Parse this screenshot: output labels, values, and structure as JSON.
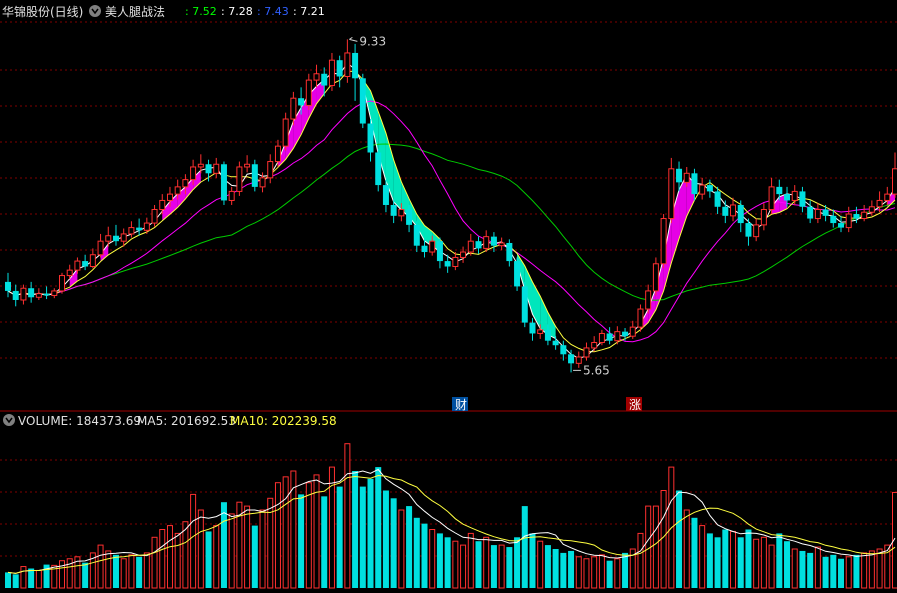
{
  "header": {
    "stock_name": "华锦股份(日线)",
    "indicator_name": "美人腿战法",
    "values": [
      {
        "text": ": 7.52",
        "color": "#00ff00"
      },
      {
        "text": ": 7.28",
        "color": "#ffffff"
      },
      {
        "text": ": 7.43",
        "color": "#3060ff"
      },
      {
        "text": ": 7.21",
        "color": "#ffffff"
      }
    ]
  },
  "volume_header": {
    "volume_text": "VOLUME: 184373.69",
    "ma5_text": "MA5: 201692.53",
    "ma10_text": "MA10: 202239.58"
  },
  "annotations": {
    "high": "9.33",
    "low": "5.65",
    "cai_tag": "财",
    "zhang_tag": "涨"
  },
  "colors": {
    "up": "#ff3030",
    "down": "#00e0e0",
    "ma_short": "#ffffff",
    "ma_mid": "#ffff40",
    "ma_long": "#ff00ff",
    "ma_longest": "#00cc00",
    "grid": "#800000",
    "fill_up": "#ff00ff",
    "fill_down": "#00ffd0"
  },
  "chart_data": {
    "type": "candlestick",
    "ylim": [
      5.4,
      9.5
    ],
    "vol_max": 400000,
    "candles": [
      [
        6.65,
        6.55,
        6.75,
        6.48
      ],
      [
        6.55,
        6.45,
        6.62,
        6.38
      ],
      [
        6.45,
        6.58,
        6.62,
        6.4
      ],
      [
        6.58,
        6.48,
        6.65,
        6.42
      ],
      [
        6.48,
        6.52,
        6.58,
        6.45
      ],
      [
        6.52,
        6.5,
        6.6,
        6.46
      ],
      [
        6.5,
        6.55,
        6.58,
        6.47
      ],
      [
        6.55,
        6.72,
        6.75,
        6.52
      ],
      [
        6.72,
        6.78,
        6.84,
        6.68
      ],
      [
        6.78,
        6.88,
        6.92,
        6.74
      ],
      [
        6.88,
        6.82,
        6.95,
        6.78
      ],
      [
        6.82,
        6.95,
        7.02,
        6.8
      ],
      [
        6.95,
        7.1,
        7.18,
        6.92
      ],
      [
        7.1,
        7.16,
        7.26,
        7.04
      ],
      [
        7.16,
        7.1,
        7.28,
        7.05
      ],
      [
        7.1,
        7.18,
        7.24,
        7.04
      ],
      [
        7.18,
        7.25,
        7.32,
        7.14
      ],
      [
        7.25,
        7.22,
        7.35,
        7.16
      ],
      [
        7.22,
        7.3,
        7.36,
        7.18
      ],
      [
        7.3,
        7.45,
        7.5,
        7.26
      ],
      [
        7.45,
        7.55,
        7.62,
        7.4
      ],
      [
        7.55,
        7.62,
        7.7,
        7.48
      ],
      [
        7.62,
        7.7,
        7.78,
        7.56
      ],
      [
        7.7,
        7.78,
        7.84,
        7.62
      ],
      [
        7.78,
        7.92,
        8.0,
        7.72
      ],
      [
        7.92,
        7.95,
        8.06,
        7.85
      ],
      [
        7.95,
        7.85,
        8.0,
        7.76
      ],
      [
        7.85,
        7.95,
        8.02,
        7.8
      ],
      [
        7.95,
        7.55,
        7.98,
        7.5
      ],
      [
        7.55,
        7.65,
        7.7,
        7.5
      ],
      [
        7.65,
        7.92,
        7.98,
        7.6
      ],
      [
        7.92,
        7.95,
        8.05,
        7.86
      ],
      [
        7.95,
        7.7,
        8.0,
        7.65
      ],
      [
        7.7,
        7.8,
        7.86,
        7.64
      ],
      [
        7.8,
        7.98,
        8.06,
        7.74
      ],
      [
        7.98,
        8.15,
        8.22,
        7.92
      ],
      [
        8.15,
        8.45,
        8.52,
        8.1
      ],
      [
        8.45,
        8.68,
        8.75,
        8.38
      ],
      [
        8.68,
        8.6,
        8.8,
        8.5
      ],
      [
        8.6,
        8.88,
        8.95,
        8.55
      ],
      [
        8.88,
        8.95,
        9.05,
        8.8
      ],
      [
        8.95,
        8.82,
        9.02,
        8.7
      ],
      [
        8.82,
        9.1,
        9.18,
        8.76
      ],
      [
        9.1,
        8.92,
        9.15,
        8.8
      ],
      [
        8.92,
        9.18,
        9.33,
        8.85
      ],
      [
        9.18,
        8.9,
        9.28,
        8.65
      ],
      [
        8.9,
        8.4,
        8.95,
        8.35
      ],
      [
        8.4,
        8.08,
        8.45,
        7.98
      ],
      [
        8.08,
        7.72,
        8.12,
        7.65
      ],
      [
        7.72,
        7.5,
        7.78,
        7.42
      ],
      [
        7.5,
        7.38,
        7.56,
        7.3
      ],
      [
        7.38,
        7.45,
        7.52,
        7.32
      ],
      [
        7.45,
        7.28,
        7.5,
        7.2
      ],
      [
        7.28,
        7.05,
        7.32,
        6.98
      ],
      [
        7.05,
        6.98,
        7.12,
        6.92
      ],
      [
        6.98,
        7.1,
        7.16,
        6.94
      ],
      [
        7.1,
        6.88,
        7.14,
        6.8
      ],
      [
        6.88,
        6.82,
        6.95,
        6.75
      ],
      [
        6.82,
        6.92,
        6.98,
        6.78
      ],
      [
        6.92,
        6.98,
        7.04,
        6.86
      ],
      [
        6.98,
        7.1,
        7.18,
        6.94
      ],
      [
        7.1,
        7.02,
        7.15,
        6.96
      ],
      [
        7.02,
        7.15,
        7.22,
        6.98
      ],
      [
        7.15,
        7.05,
        7.2,
        6.98
      ],
      [
        7.05,
        7.08,
        7.14,
        7.0
      ],
      [
        7.08,
        6.88,
        7.12,
        6.82
      ],
      [
        6.88,
        6.6,
        6.92,
        6.55
      ],
      [
        6.6,
        6.2,
        6.65,
        6.15
      ],
      [
        6.2,
        6.08,
        6.25,
        6.0
      ],
      [
        6.08,
        6.12,
        6.18,
        6.02
      ],
      [
        6.12,
        6.0,
        6.18,
        5.95
      ],
      [
        6.0,
        5.95,
        6.05,
        5.9
      ],
      [
        5.95,
        5.85,
        6.0,
        5.78
      ],
      [
        5.85,
        5.75,
        5.9,
        5.65
      ],
      [
        5.75,
        5.82,
        5.88,
        5.7
      ],
      [
        5.82,
        5.92,
        5.98,
        5.78
      ],
      [
        5.92,
        5.98,
        6.05,
        5.88
      ],
      [
        5.98,
        6.08,
        6.12,
        5.95
      ],
      [
        6.08,
        6.0,
        6.15,
        5.96
      ],
      [
        6.0,
        6.1,
        6.16,
        5.96
      ],
      [
        6.1,
        6.05,
        6.14,
        6.0
      ],
      [
        6.05,
        6.15,
        6.22,
        6.02
      ],
      [
        6.15,
        6.35,
        6.4,
        6.1
      ],
      [
        6.35,
        6.55,
        6.62,
        6.3
      ],
      [
        6.55,
        6.85,
        6.92,
        6.5
      ],
      [
        6.85,
        7.35,
        7.4,
        6.8
      ],
      [
        7.35,
        7.9,
        8.02,
        7.3
      ],
      [
        7.9,
        7.75,
        7.98,
        7.65
      ],
      [
        7.75,
        7.85,
        7.92,
        7.7
      ],
      [
        7.85,
        7.62,
        7.9,
        7.55
      ],
      [
        7.62,
        7.72,
        7.8,
        7.56
      ],
      [
        7.72,
        7.65,
        7.78,
        7.58
      ],
      [
        7.65,
        7.48,
        7.7,
        7.4
      ],
      [
        7.48,
        7.38,
        7.55,
        7.3
      ],
      [
        7.38,
        7.5,
        7.58,
        7.32
      ],
      [
        7.5,
        7.3,
        7.55,
        7.2
      ],
      [
        7.3,
        7.15,
        7.35,
        7.05
      ],
      [
        7.15,
        7.28,
        7.35,
        7.1
      ],
      [
        7.28,
        7.45,
        7.52,
        7.22
      ],
      [
        7.45,
        7.7,
        7.8,
        7.4
      ],
      [
        7.7,
        7.62,
        7.78,
        7.55
      ],
      [
        7.62,
        7.55,
        7.7,
        7.48
      ],
      [
        7.55,
        7.65,
        7.72,
        7.5
      ],
      [
        7.65,
        7.48,
        7.7,
        7.42
      ],
      [
        7.48,
        7.35,
        7.55,
        7.3
      ],
      [
        7.35,
        7.45,
        7.52,
        7.3
      ],
      [
        7.45,
        7.38,
        7.5,
        7.32
      ],
      [
        7.38,
        7.3,
        7.45,
        7.25
      ],
      [
        7.3,
        7.25,
        7.38,
        7.2
      ],
      [
        7.25,
        7.4,
        7.48,
        7.2
      ],
      [
        7.4,
        7.35,
        7.48,
        7.3
      ],
      [
        7.35,
        7.42,
        7.5,
        7.32
      ],
      [
        7.42,
        7.48,
        7.55,
        7.38
      ],
      [
        7.48,
        7.55,
        7.65,
        7.42
      ],
      [
        7.55,
        7.62,
        7.7,
        7.5
      ],
      [
        7.62,
        7.9,
        8.08,
        7.58
      ]
    ],
    "volume": [
      40000,
      35000,
      55000,
      50000,
      45000,
      60000,
      58000,
      70000,
      75000,
      80000,
      65000,
      90000,
      110000,
      95000,
      85000,
      75000,
      85000,
      80000,
      90000,
      130000,
      150000,
      160000,
      140000,
      170000,
      240000,
      200000,
      145000,
      160000,
      220000,
      190000,
      220000,
      210000,
      160000,
      200000,
      230000,
      270000,
      285000,
      300000,
      240000,
      270000,
      290000,
      235000,
      310000,
      260000,
      370000,
      300000,
      260000,
      280000,
      310000,
      250000,
      230000,
      200000,
      210000,
      180000,
      165000,
      150000,
      140000,
      130000,
      120000,
      110000,
      140000,
      120000,
      130000,
      110000,
      110000,
      105000,
      130000,
      210000,
      140000,
      120000,
      110000,
      100000,
      90000,
      95000,
      80000,
      75000,
      80000,
      85000,
      70000,
      75000,
      90000,
      100000,
      140000,
      210000,
      210000,
      250000,
      310000,
      250000,
      200000,
      180000,
      160000,
      140000,
      130000,
      150000,
      145000,
      130000,
      150000,
      125000,
      130000,
      110000,
      140000,
      120000,
      100000,
      95000,
      90000,
      105000,
      80000,
      85000,
      75000,
      80000,
      85000,
      90000,
      95000,
      100000,
      110000,
      245000
    ]
  }
}
